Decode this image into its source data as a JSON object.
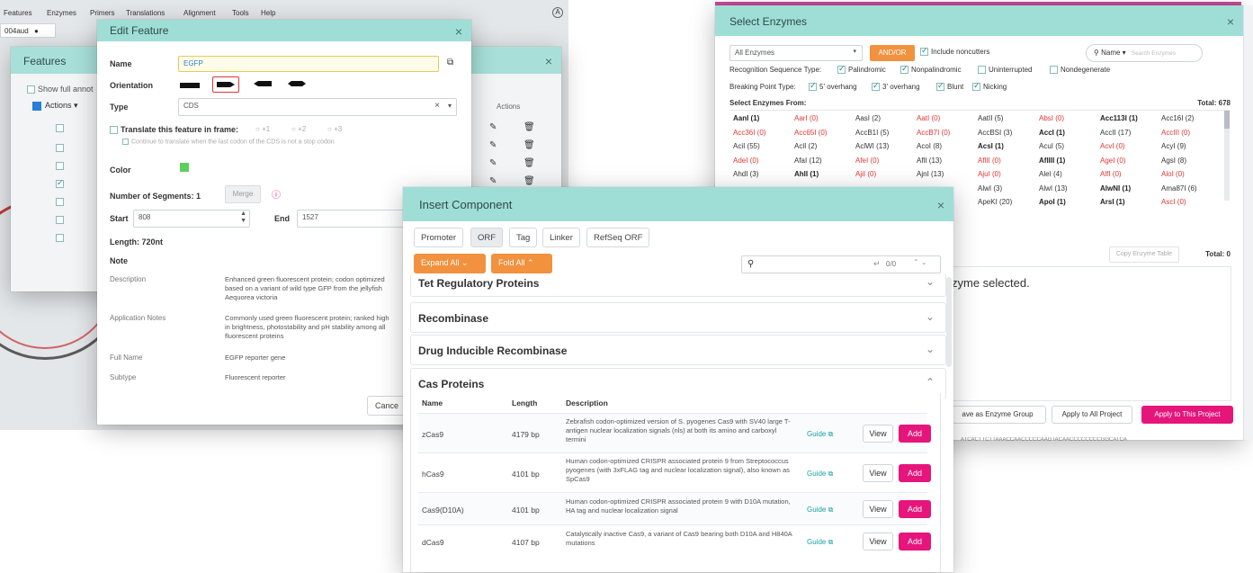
{
  "bg_menu": [
    "Features",
    "Enzymes",
    "Primers",
    "Translations",
    "Alignment",
    "Tools",
    "Help"
  ],
  "bg_tab": "004aud",
  "features_win": {
    "title": "Features",
    "show_full": "Show full annot",
    "actions": "Actions",
    "actions_col": "Actions"
  },
  "edit_feature": {
    "title": "Edit Feature",
    "name_label": "Name",
    "name_value": "EGFP",
    "orientation_label": "Orientation",
    "type_label": "Type",
    "type_value": "CDS",
    "translate_label": "Translate this feature in frame:",
    "frames": [
      "+1",
      "+2",
      "+3"
    ],
    "continue_text": "Continue to translate when the last codon of the CDS is not a stop codon",
    "color_label": "Color",
    "color_value": "#5ccf5c",
    "segments_label": "Number of Segments: 1",
    "merge_label": "Merge",
    "start_label": "Start",
    "start_value": "808",
    "end_label": "End",
    "end_value": "1527",
    "length_label": "Length: 720nt",
    "note_label": "Note",
    "desc_key": "Description",
    "desc_val": "Enhanced green fluorescent protein; codon optimized based on a variant of wild type GFP from the jellyfish Aequorea victoria",
    "app_key": "Application Notes",
    "app_val": "Commonly used green fluorescent protein; ranked high in brightness, photostability and pH stability among all fluorescent proteins",
    "fullname_key": "Full Name",
    "fullname_val": "EGFP reporter gene",
    "subtype_key": "Subtype",
    "subtype_val": "Fluorescent reporter",
    "cancel": "Cance"
  },
  "select_enzymes": {
    "title": "Select Enzymes",
    "filter_value": "All Enzymes",
    "andor": "AND/OR",
    "include_noncutters": "Include noncutters",
    "search_mode": "Name",
    "search_placeholder": "Search Enzymes",
    "recog_label": "Recognition Sequence Type:",
    "recog_opts": [
      "Palindromic",
      "Nonpalindromic",
      "Uninterrupted",
      "Nondegenerate"
    ],
    "break_label": "Breaking Point Type:",
    "break_opts": [
      "5' overhang",
      "3' overhang",
      "Blunt",
      "Nicking"
    ],
    "select_from": "Select Enzymes From:",
    "total": "Total: 678",
    "enzymes": [
      [
        [
          "AanI (1)",
          "b"
        ],
        [
          "AarI (0)",
          "r"
        ],
        [
          "AasI (2)",
          ""
        ],
        [
          "AatI (0)",
          "r"
        ],
        [
          "AatII (5)",
          ""
        ],
        [
          "AbsI (0)",
          "r"
        ],
        [
          "Acc113I (1)",
          "b"
        ],
        [
          "Acc16I (2)",
          ""
        ]
      ],
      [
        [
          "Acc36I (0)",
          "r"
        ],
        [
          "Acc65I (0)",
          "r"
        ],
        [
          "AccB1I (5)",
          ""
        ],
        [
          "AccB7I (0)",
          "r"
        ],
        [
          "AccBSI (3)",
          ""
        ],
        [
          "AccI (1)",
          "b"
        ],
        [
          "AccII (17)",
          ""
        ],
        [
          "AccIII (0)",
          "r"
        ]
      ],
      [
        [
          "AciI (55)",
          ""
        ],
        [
          "AclI (2)",
          ""
        ],
        [
          "AclWI (13)",
          ""
        ],
        [
          "AcoI (8)",
          ""
        ],
        [
          "AcsI (1)",
          "b"
        ],
        [
          "AcuI (5)",
          ""
        ],
        [
          "AcvI (0)",
          "r"
        ],
        [
          "AcyI (9)",
          ""
        ]
      ],
      [
        [
          "AdeI (0)",
          "r"
        ],
        [
          "AfaI (12)",
          ""
        ],
        [
          "AfeI (0)",
          "r"
        ],
        [
          "AflI (13)",
          ""
        ],
        [
          "AflII (0)",
          "r"
        ],
        [
          "AflIII (1)",
          "b"
        ],
        [
          "AgeI (0)",
          "r"
        ],
        [
          "AgsI (8)",
          ""
        ]
      ],
      [
        [
          "AhdI (3)",
          ""
        ],
        [
          "AhlI (1)",
          "b"
        ],
        [
          "AjiI (0)",
          "r"
        ],
        [
          "AjnI (13)",
          ""
        ],
        [
          "AjuI (0)",
          "r"
        ],
        [
          "AleI (4)",
          ""
        ],
        [
          "AlfI (0)",
          "r"
        ],
        [
          "AloI (0)",
          "r"
        ]
      ],
      [
        [
          "",
          ""
        ],
        [
          "",
          ""
        ],
        [
          "",
          ""
        ],
        [
          "",
          ""
        ],
        [
          "AlwI (3)",
          ""
        ],
        [
          "AlwI (13)",
          ""
        ],
        [
          "AlwNI (1)",
          "b"
        ],
        [
          "Ama87I (6)",
          ""
        ]
      ],
      [
        [
          "",
          ""
        ],
        [
          "",
          ""
        ],
        [
          "",
          ""
        ],
        [
          "",
          ""
        ],
        [
          "ApeKI (20)",
          ""
        ],
        [
          "ApoI (1)",
          "b"
        ],
        [
          "ArsI (1)",
          "b"
        ],
        [
          "AscI (0)",
          "r"
        ]
      ]
    ],
    "copy_table": "Copy Enzyme Table",
    "total_selected": "Total: 0",
    "none_selected": "zyme selected.",
    "save_group": "ave as Enzyme Group",
    "apply_all": "Apply to All Project",
    "apply_this": "Apply to This Project",
    "seq_strip": "ATCACTTCTTAAACCAACCCCCAAGTACAACCCCCCCCGGCATCA"
  },
  "insert_component": {
    "title": "Insert Component",
    "tabs": [
      "Promoter",
      "ORF",
      "Tag",
      "Linker",
      "RefSeq ORF"
    ],
    "expand_all": "Expand All",
    "fold_all": "Fold All",
    "search_count": "0/0",
    "sections": [
      "Tet Regulatory Proteins",
      "Recombinase",
      "Drug Inducible Recombinase",
      "Cas Proteins"
    ],
    "columns": [
      "Name",
      "Length",
      "Description"
    ],
    "guide": "Guide",
    "view": "View",
    "add": "Add",
    "rows": [
      {
        "name": "zCas9",
        "length": "4179 bp",
        "desc": "Zebrafish codon-optimized version of S. pyogenes Cas9 with SV40 large T-antigen nuclear localization signals (nls) at both its amino and carboxyl termini"
      },
      {
        "name": "hCas9",
        "length": "4101 bp",
        "desc": "Human codon-optimized CRISPR associated protein 9 from Streptococcus pyogenes (with 3xFLAG tag and nuclear localization signal), also known as SpCas9"
      },
      {
        "name": "Cas9(D10A)",
        "length": "4101 bp",
        "desc": "Human codon-optimized CRISPR associated protein 9 with D10A mutation, HA tag and nuclear localization signal"
      },
      {
        "name": "dCas9",
        "length": "4107 bp",
        "desc": "Catalytically inactive Cas9, a variant of Cas9 bearing both D10A and H840A mutations"
      }
    ]
  }
}
